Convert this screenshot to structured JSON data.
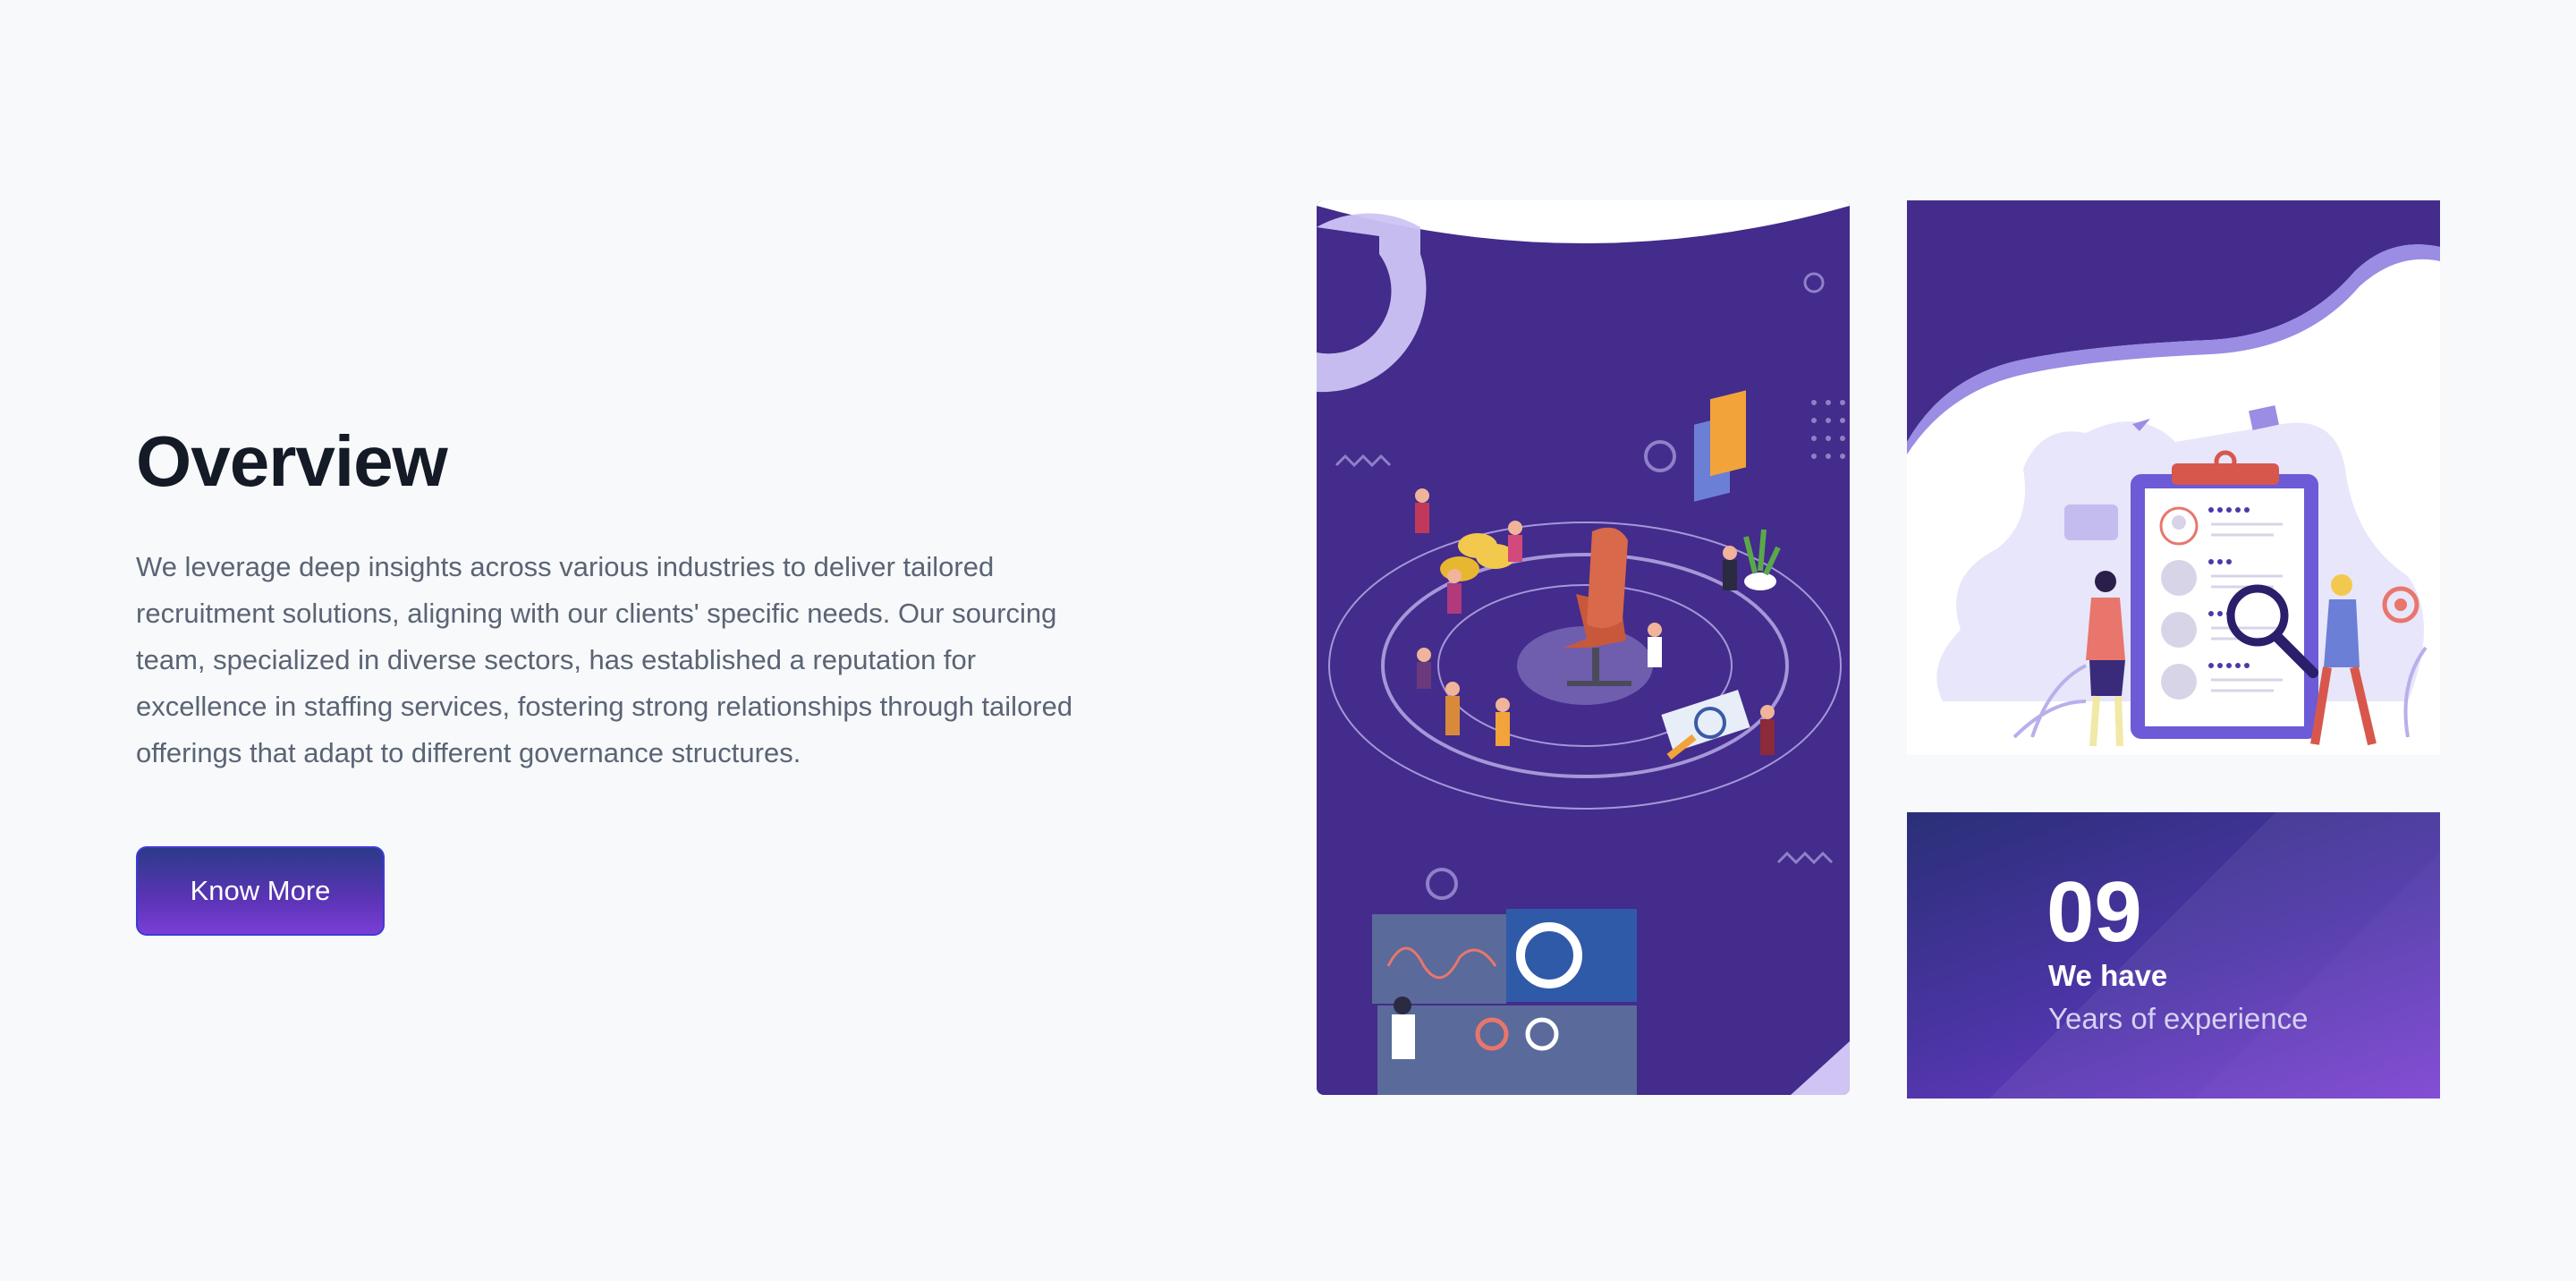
{
  "overview": {
    "title": "Overview",
    "description": "We leverage deep insights across various industries to deliver tailored recruitment solutions, aligning with our clients' specific needs. Our sourcing team, specialized in diverse sectors, has established a reputation for excellence in staffing services, fostering strong relationships through tailored offerings that adapt to different governance structures.",
    "button_label": "Know More"
  },
  "stat": {
    "number": "09",
    "label": "We have",
    "sublabel": "Years of experience"
  },
  "colors": {
    "background": "#f7f9fb",
    "title": "#141a26",
    "body_text": "#5b6474",
    "accent_purple": "#432c8c",
    "button_gradient_start": "#2c3a8a",
    "button_gradient_end": "#7a3ed6"
  },
  "illustrations": {
    "tall_card": "office-chair-team-illustration",
    "top_right_card": "recruitment-clipboard-illustration"
  }
}
